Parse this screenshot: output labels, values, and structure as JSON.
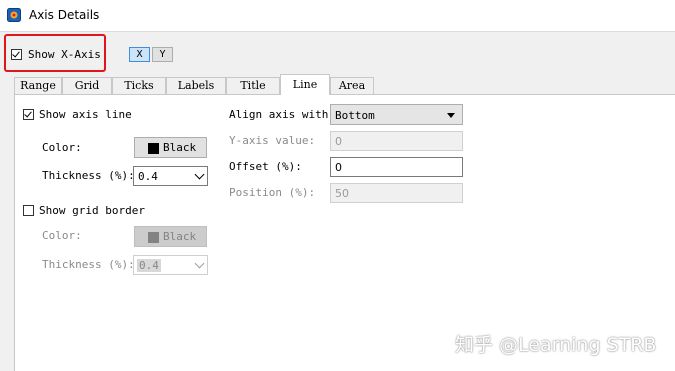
{
  "window": {
    "title": "Axis Details"
  },
  "header": {
    "show_x_axis_label": "Show X-Axis",
    "show_x_axis_checked": true,
    "axis_buttons": [
      "X",
      "Y"
    ],
    "selected_axis": "X"
  },
  "tabs": [
    {
      "label": "Range"
    },
    {
      "label": "Grid"
    },
    {
      "label": "Ticks"
    },
    {
      "label": "Labels"
    },
    {
      "label": "Title"
    },
    {
      "label": "Line"
    },
    {
      "label": "Area"
    }
  ],
  "active_tab": "Line",
  "line_panel": {
    "show_axis_line": {
      "label": "Show axis line",
      "checked": true
    },
    "axis_color_label": "Color:",
    "axis_color_value": "Black",
    "axis_thickness_label": "Thickness (%):",
    "axis_thickness_value": "0.4",
    "show_grid_border": {
      "label": "Show grid border",
      "checked": false
    },
    "grid_color_label": "Color:",
    "grid_color_value": "Black",
    "grid_thickness_label": "Thickness (%):",
    "grid_thickness_value": "0.4",
    "align_axis_label": "Align axis with:",
    "align_axis_value": "Bottom",
    "y_axis_value_label": "Y-axis value:",
    "y_axis_value": "0",
    "offset_label": "Offset (%):",
    "offset_value": "0",
    "position_label": "Position (%):",
    "position_value": "50"
  },
  "watermark": "知乎 @Learning STRB",
  "colors": {
    "highlight_border": "#e0161b",
    "selected_button": "#cce4f7",
    "selected_button_border": "#3d8ee0"
  },
  "icons": {
    "app": "app-icon",
    "dropdown": "chevron-down-icon",
    "check": "checkmark-icon"
  }
}
